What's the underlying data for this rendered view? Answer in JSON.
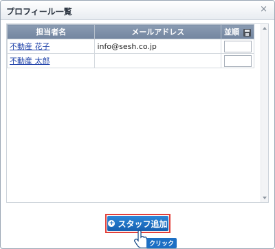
{
  "window": {
    "title": "プロフィール一覧"
  },
  "table": {
    "headers": {
      "name": "担当者名",
      "email": "メールアドレス",
      "order": "並順"
    },
    "rows": [
      {
        "name": "不動産 花子",
        "email": "info@sesh.co.jp"
      },
      {
        "name": "不動産 太郎",
        "email": ""
      }
    ]
  },
  "actions": {
    "add_staff": "スタッフ追加"
  },
  "cursor_label": "クリック",
  "colors": {
    "header": "#7f91a8",
    "button": "#1f6fc2",
    "highlight": "#e2403a"
  }
}
